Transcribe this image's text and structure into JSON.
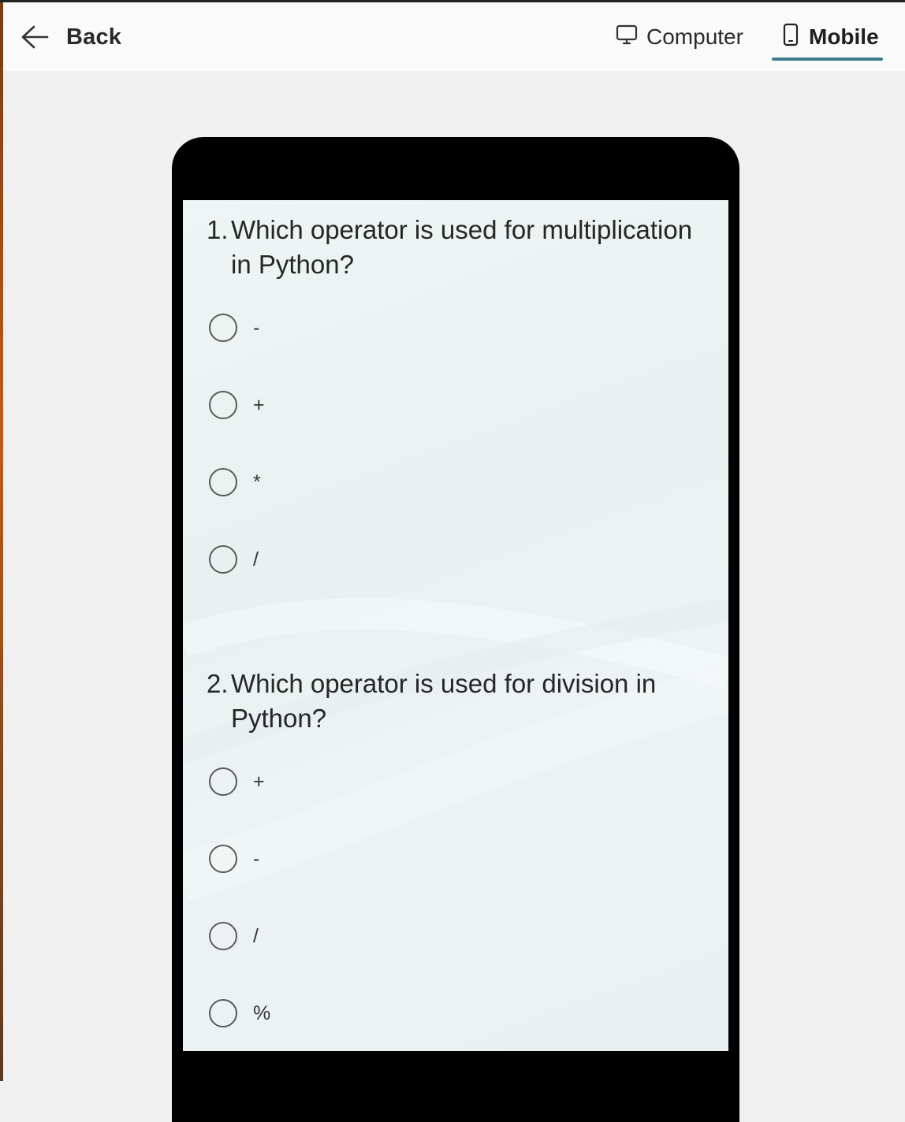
{
  "header": {
    "back_label": "Back",
    "tabs": [
      {
        "label": "Computer",
        "icon": "monitor-icon",
        "selected": false
      },
      {
        "label": "Mobile",
        "icon": "phone-icon",
        "selected": true
      }
    ],
    "accent_color": "#3a7d8c"
  },
  "questions": [
    {
      "number": "1.",
      "text": "Which operator is used for multiplication in Python?",
      "options": [
        "-",
        "+",
        "*",
        "/"
      ]
    },
    {
      "number": "2.",
      "text": "Which operator is used for division in Python?",
      "options": [
        "+",
        "-",
        "/",
        "%"
      ]
    }
  ]
}
